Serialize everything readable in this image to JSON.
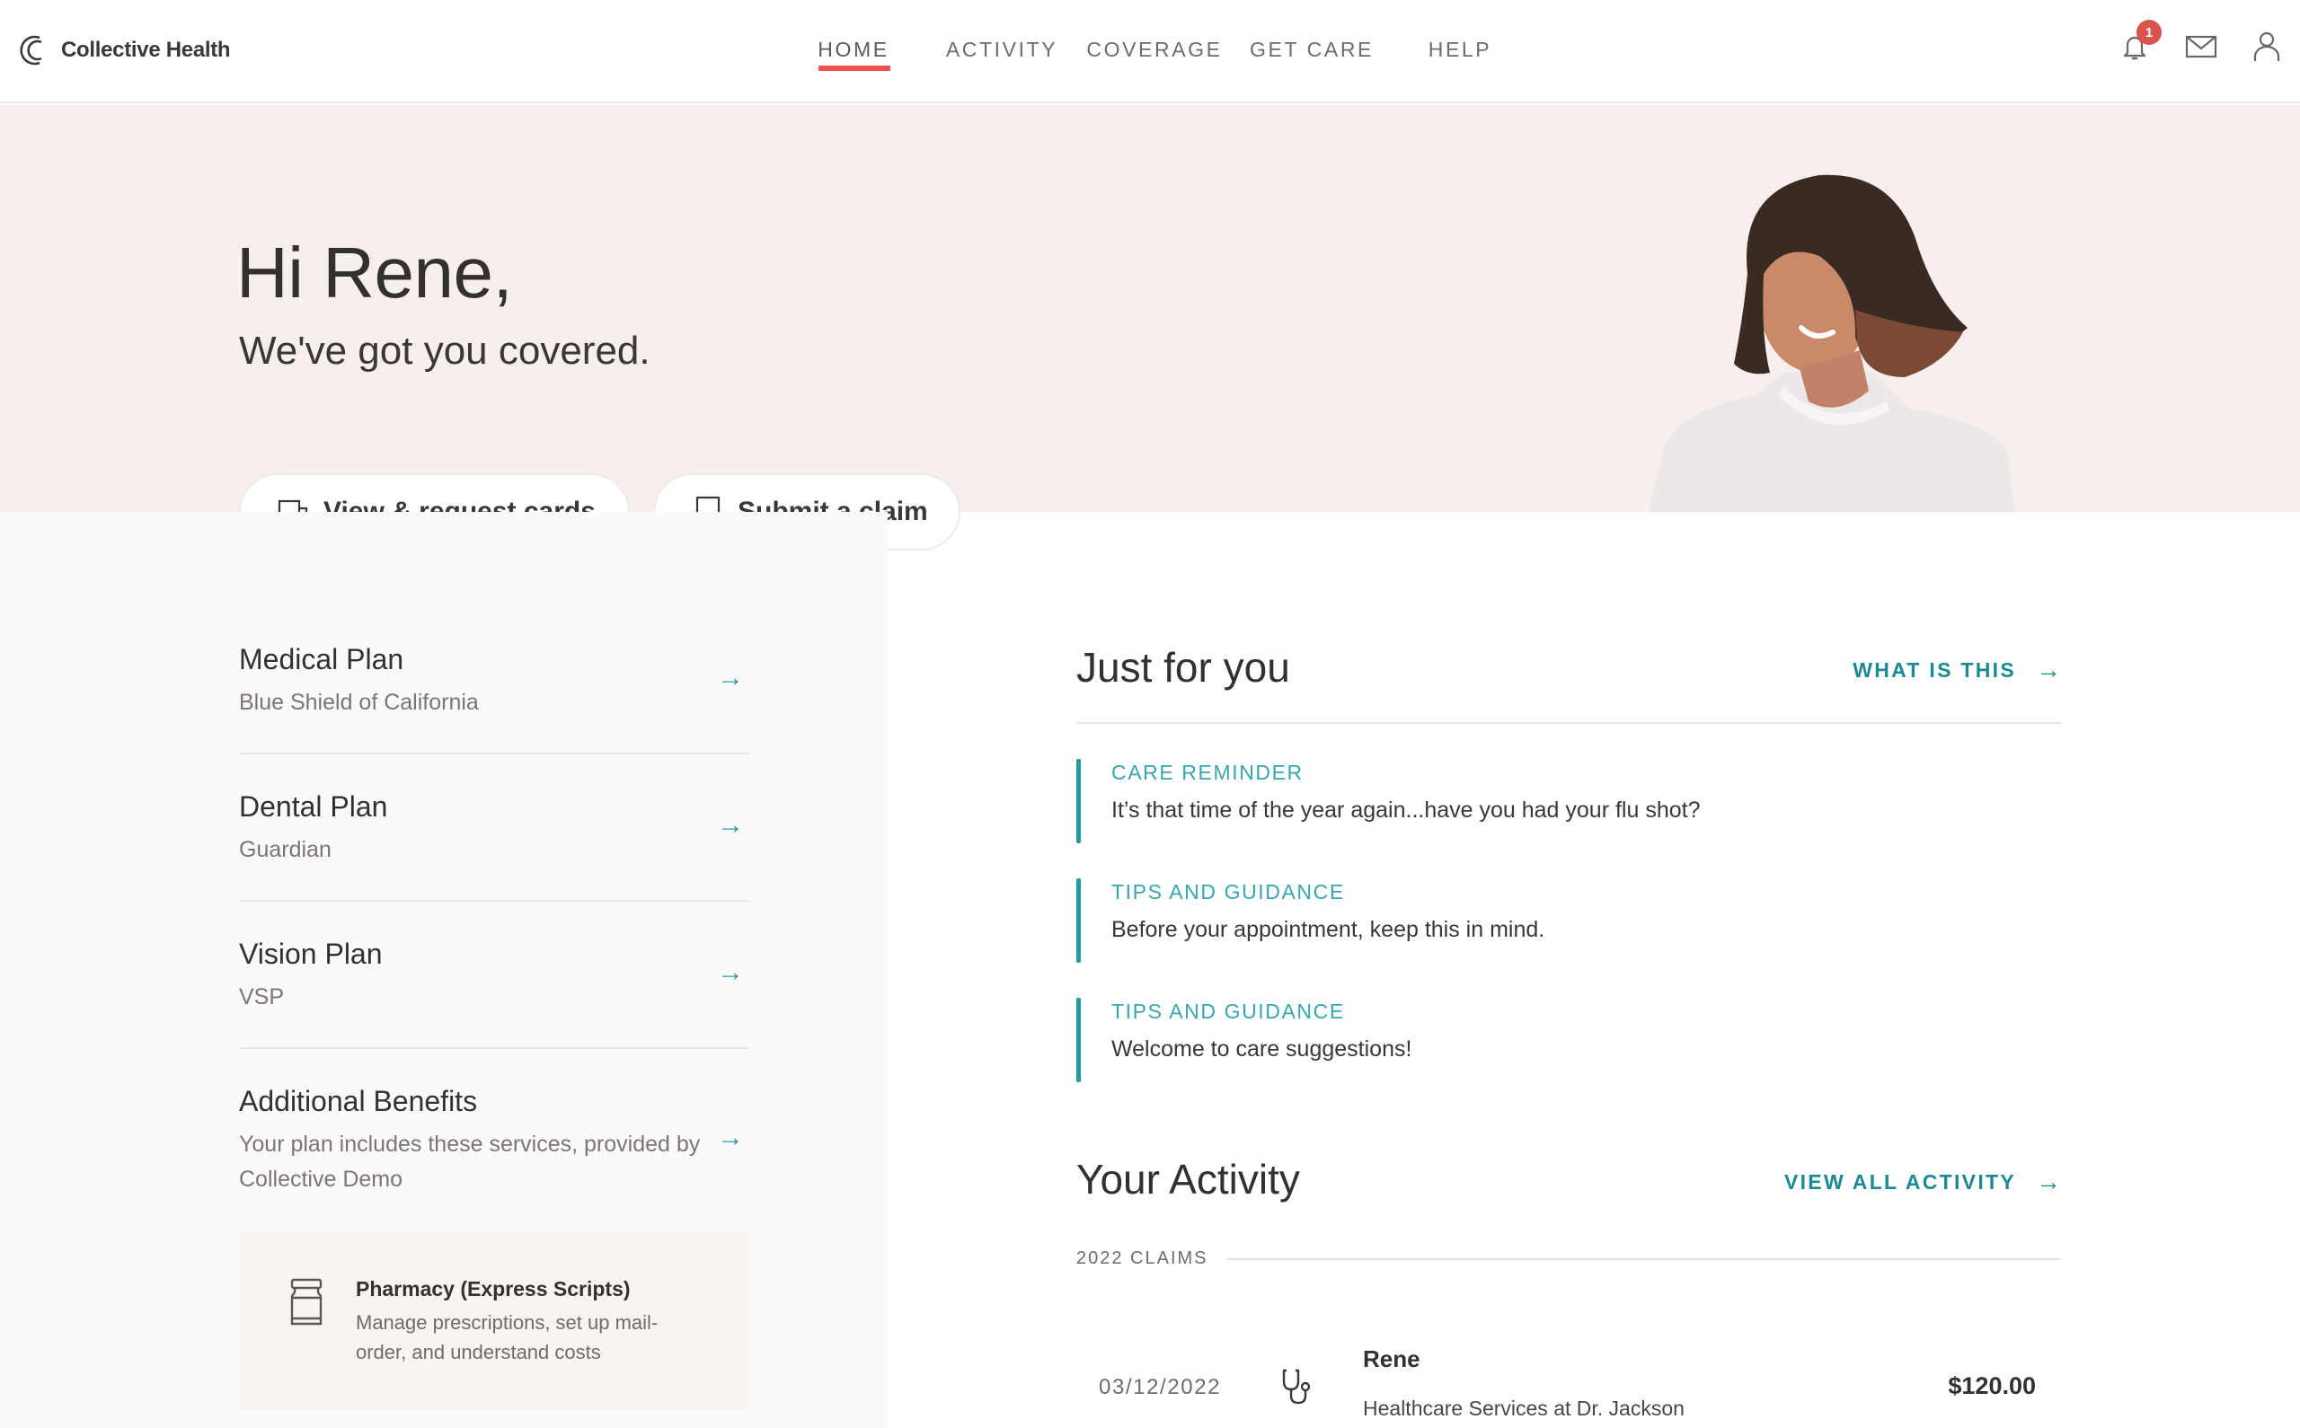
{
  "brand": {
    "name": "Collective Health",
    "accent": "#1b8a93",
    "nav_active_color": "#ef5350",
    "hero_bg": "#f6efed"
  },
  "nav": {
    "items": [
      {
        "label": "HOME",
        "active": true
      },
      {
        "label": "ACTIVITY",
        "active": false
      },
      {
        "label": "COVERAGE",
        "active": false
      },
      {
        "label": "GET CARE",
        "active": false
      },
      {
        "label": "HELP",
        "active": false
      }
    ],
    "notifications_count": "1",
    "icons": [
      "bell-icon",
      "mail-icon",
      "user-icon"
    ]
  },
  "hero": {
    "greeting": "Hi Rene,",
    "tagline": "We've got you covered.",
    "buttons": [
      {
        "label": "View & request cards",
        "icon": "cards-icon"
      },
      {
        "label": "Submit a claim",
        "icon": "receipt-icon"
      }
    ]
  },
  "plans": [
    {
      "title": "Medical Plan",
      "subtitle": "Blue Shield of California"
    },
    {
      "title": "Dental Plan",
      "subtitle": "Guardian"
    },
    {
      "title": "Vision Plan",
      "subtitle": "VSP"
    },
    {
      "title": "Additional Benefits",
      "subtitle": "Your plan includes these services, provided by Collective Demo"
    }
  ],
  "pharmacy": {
    "title": "Pharmacy (Express Scripts)",
    "description": "Manage prescriptions, set up mail-order, and understand costs"
  },
  "just_for_you": {
    "title": "Just for you",
    "link": "WHAT IS THIS",
    "items": [
      {
        "category": "CARE REMINDER",
        "text": "It’s that time of the year again...have you had your flu shot?"
      },
      {
        "category": "TIPS AND GUIDANCE",
        "text": "Before your appointment, keep this in mind."
      },
      {
        "category": "TIPS AND GUIDANCE",
        "text": "Welcome to care suggestions!"
      }
    ]
  },
  "activity": {
    "title": "Your Activity",
    "link": "VIEW ALL ACTIVITY",
    "group_label": "2022 CLAIMS",
    "claims": [
      {
        "date": "03/12/2022",
        "icon": "stethoscope-icon",
        "patient": "Rene",
        "description": "Healthcare Services at Dr. Jackson",
        "amount": "$120.00"
      }
    ]
  }
}
